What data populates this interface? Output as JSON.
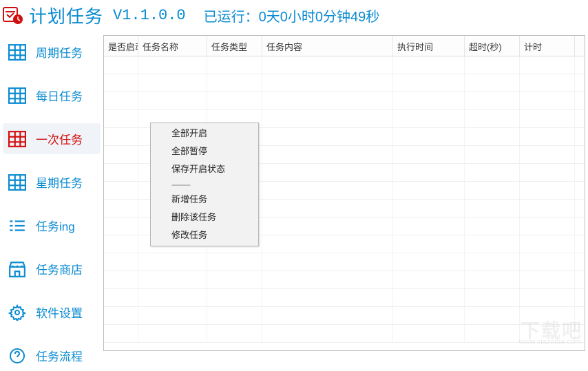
{
  "header": {
    "title": "计划任务",
    "version": "V1.1.0.0",
    "runtime_prefix": "已运行：",
    "runtime_value": "0天0小时0分钟49秒"
  },
  "sidebar": {
    "items": [
      {
        "label": "周期任务",
        "icon": "grid-icon",
        "active": false
      },
      {
        "label": "每日任务",
        "icon": "grid-icon",
        "active": false
      },
      {
        "label": "一次任务",
        "icon": "grid-icon",
        "active": true
      },
      {
        "label": "星期任务",
        "icon": "grid-icon",
        "active": false
      },
      {
        "label": "任务ing",
        "icon": "list-icon",
        "active": false
      },
      {
        "label": "任务商店",
        "icon": "store-icon",
        "active": false
      },
      {
        "label": "软件设置",
        "icon": "gear-icon",
        "active": false
      },
      {
        "label": "任务流程",
        "icon": "help-icon",
        "active": false
      }
    ]
  },
  "table": {
    "columns": [
      "是否启动",
      "任务名称",
      "任务类型",
      "任务内容",
      "执行时间",
      "超时(秒)",
      "计时"
    ],
    "rows": []
  },
  "context_menu": {
    "items": [
      {
        "label": "全部开启",
        "type": "item"
      },
      {
        "label": "全部暂停",
        "type": "item"
      },
      {
        "label": "保存开启状态",
        "type": "item"
      },
      {
        "label": "---------",
        "type": "sep"
      },
      {
        "label": "新增任务",
        "type": "item"
      },
      {
        "label": "删除该任务",
        "type": "item"
      },
      {
        "label": "修改任务",
        "type": "item"
      }
    ]
  },
  "watermark": {
    "main": "下载吧",
    "sub": "www.xiazaiba.com"
  }
}
